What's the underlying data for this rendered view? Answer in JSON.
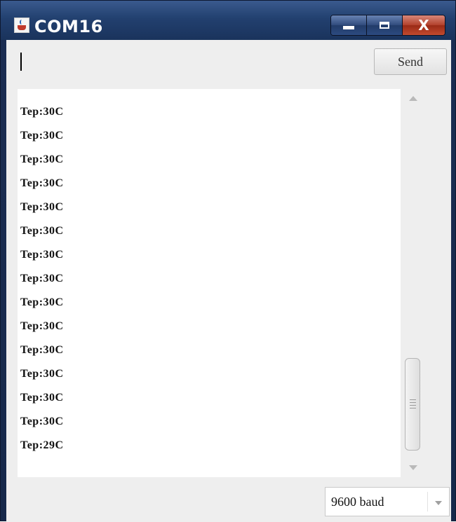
{
  "window": {
    "title": "COM16",
    "close_label": "X"
  },
  "input": {
    "value": "",
    "placeholder": ""
  },
  "toolbar": {
    "send_label": "Send"
  },
  "output": {
    "lines": [
      "Tep:30C",
      "Tep:30C",
      "Tep:30C",
      "Tep:30C",
      "Tep:30C",
      "Tep:30C",
      "Tep:30C",
      "Tep:30C",
      "Tep:30C",
      "Tep:30C",
      "Tep:30C",
      "Tep:30C",
      "Tep:30C",
      "Tep:30C",
      "Tep:29C"
    ]
  },
  "footer": {
    "baud_rate": "9600 baud"
  },
  "icons": {
    "app": "java-cup-icon",
    "minimize": "minimize-icon",
    "maximize": "maximize-icon",
    "close": "close-icon"
  },
  "colors": {
    "titlebar": "#22406f",
    "close_button": "#b2402b",
    "client_bg": "#eeeeee",
    "text": "#111111"
  }
}
